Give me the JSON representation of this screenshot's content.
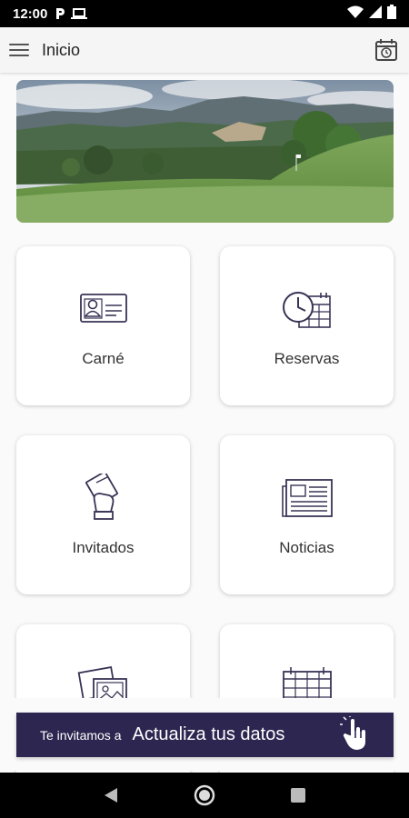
{
  "status_bar": {
    "time": "12:00",
    "left_icons": [
      "parking-icon",
      "laptop-icon"
    ],
    "right_icons": [
      "wifi-icon",
      "signal-icon",
      "battery-icon"
    ]
  },
  "app_bar": {
    "title": "Inicio",
    "menu_icon": "hamburger-menu-icon",
    "action_icon": "calendar-clock-icon"
  },
  "banner": {
    "image": "golf-course-landscape"
  },
  "tiles": [
    {
      "label": "Carné",
      "icon": "id-card-icon"
    },
    {
      "label": "Reservas",
      "icon": "clock-calendar-icon"
    },
    {
      "label": "Invitados",
      "icon": "guest-pass-icon"
    },
    {
      "label": "Noticias",
      "icon": "newspaper-icon"
    },
    {
      "label": "",
      "icon": "photo-gallery-icon"
    },
    {
      "label": "",
      "icon": "calendar-icon"
    }
  ],
  "promo": {
    "small_text": "Te invitamos a",
    "big_text": "Actualiza tus datos",
    "icon": "pointing-hand-icon"
  },
  "nav_bar": {
    "buttons": [
      "back-icon",
      "home-icon",
      "recents-icon"
    ]
  },
  "colors": {
    "promo_bg": "#2d2650",
    "icon_stroke": "#3a3355",
    "app_bar_bg": "#f5f5f5"
  }
}
